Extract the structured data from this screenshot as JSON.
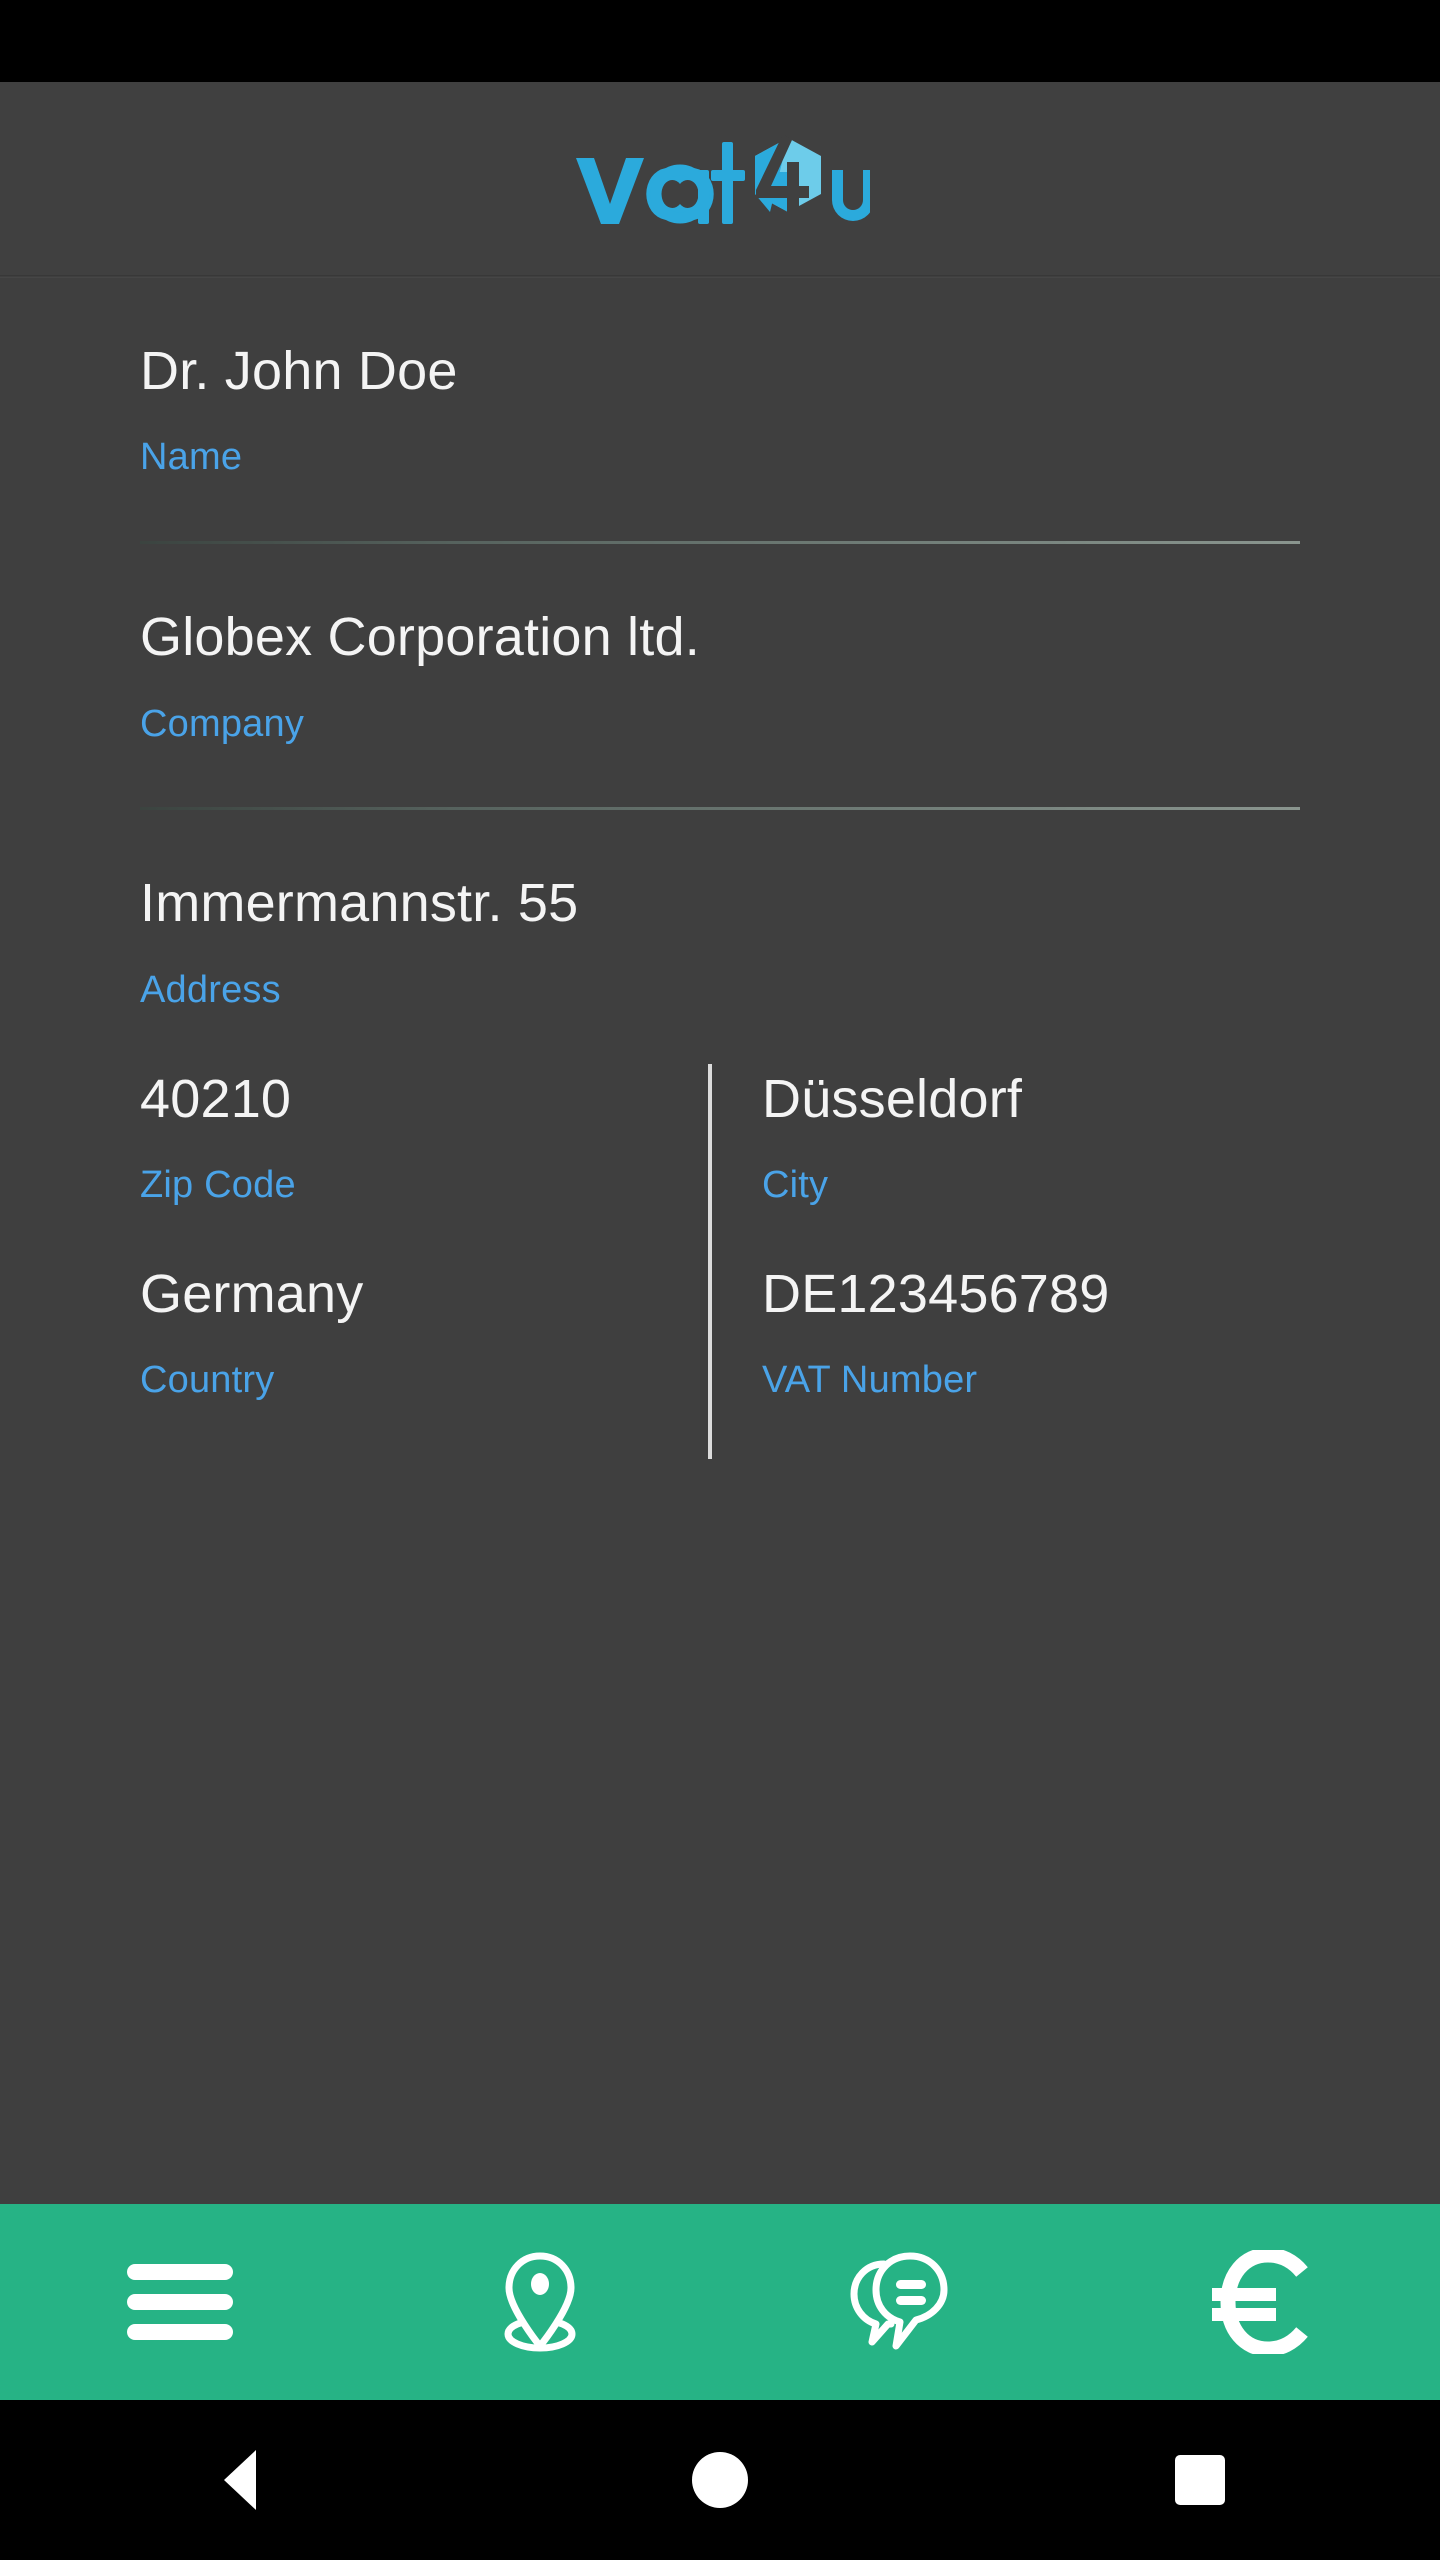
{
  "app": {
    "logo_text": "vat4u",
    "logo_colors": {
      "text_blue": "#2BAADC",
      "hex_dark": "#2BAADC",
      "hex_light": "#6DCCEA"
    },
    "header_bg": "#404040",
    "content_bg": "#3f3f3f",
    "accent_green": "#26b385",
    "label_blue": "#4aa3e8",
    "value_white": "#f4f4f4"
  },
  "form": {
    "name": {
      "value": "Dr. John Doe",
      "label": "Name"
    },
    "company": {
      "value": "Globex Corporation ltd.",
      "label": "Company"
    },
    "address": {
      "value": "Immermannstr. 55",
      "label": "Address"
    },
    "zip": {
      "value": "40210",
      "label": "Zip Code"
    },
    "city": {
      "value": "Düsseldorf",
      "label": "City"
    },
    "country": {
      "value": "Germany",
      "label": "Country"
    },
    "vat": {
      "value": "DE123456789",
      "label": "VAT Number"
    }
  },
  "bottom_nav": {
    "items": [
      {
        "icon": "menu-icon",
        "name": "menu"
      },
      {
        "icon": "location-pin-icon",
        "name": "location"
      },
      {
        "icon": "chat-bubbles-icon",
        "name": "messages"
      },
      {
        "icon": "euro-icon",
        "name": "refund"
      }
    ]
  },
  "system_nav": {
    "back": "back-triangle-icon",
    "home": "home-circle-icon",
    "recents": "recents-square-icon"
  }
}
